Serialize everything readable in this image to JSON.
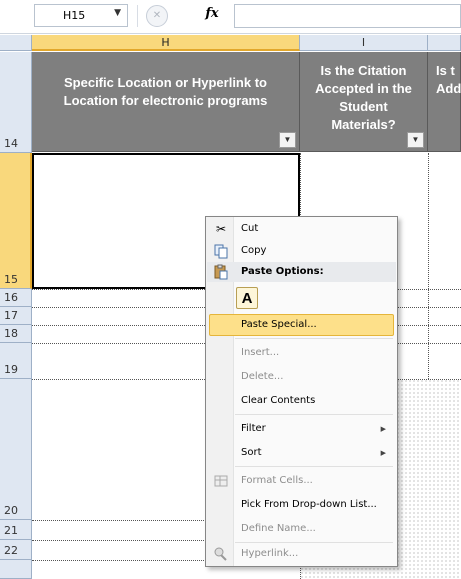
{
  "formula_bar": {
    "name_box": "H15",
    "fx": "fx",
    "formula": ""
  },
  "columns": [
    "H",
    "I"
  ],
  "rows": [
    "14",
    "15",
    "16",
    "17",
    "18",
    "19",
    "20",
    "21",
    "22"
  ],
  "headers": {
    "H": "Specific Location or Hyperlink to Location for electronic programs",
    "I": "Is the Citation Accepted in the Student Materials?",
    "J": "Is t Add"
  },
  "context_menu": {
    "items": [
      {
        "label": "Cut",
        "icon": "scissors-icon",
        "enabled": true
      },
      {
        "label": "Copy",
        "icon": "copy-icon",
        "enabled": true
      },
      {
        "label": "Paste Options:",
        "icon": "paste-icon",
        "header": true
      },
      {
        "label": "A",
        "icon": "paste-values-icon"
      },
      {
        "label": "Paste Special...",
        "enabled": true,
        "highlighted": true
      },
      {
        "label": "Insert...",
        "enabled": false
      },
      {
        "label": "Delete...",
        "enabled": false
      },
      {
        "label": "Clear Contents",
        "enabled": true
      },
      {
        "label": "Filter",
        "enabled": true,
        "submenu": true
      },
      {
        "label": "Sort",
        "enabled": true,
        "submenu": true
      },
      {
        "label": "Format Cells...",
        "icon": "format-cells-icon",
        "enabled": false
      },
      {
        "label": "Pick From Drop-down List...",
        "enabled": true
      },
      {
        "label": "Define Name...",
        "enabled": false
      },
      {
        "label": "Hyperlink...",
        "icon": "hyperlink-icon",
        "enabled": false
      }
    ]
  }
}
